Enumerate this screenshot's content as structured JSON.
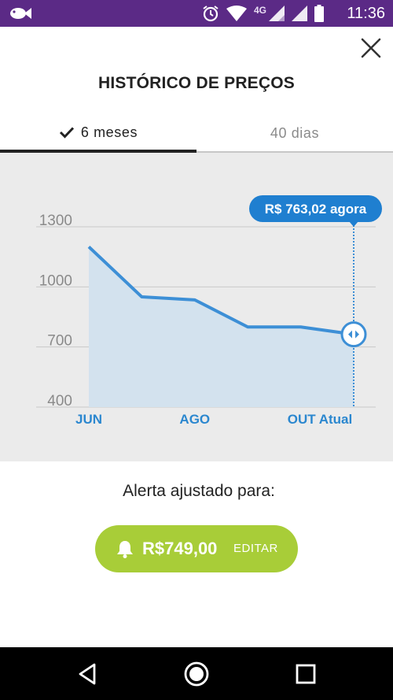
{
  "status_bar": {
    "app_icon": "fish-icon",
    "network_type": "4G",
    "time": "11:36",
    "icons": [
      "alarm-icon",
      "wifi-icon",
      "cell-signal-icon",
      "cell-signal-icon",
      "battery-icon"
    ]
  },
  "header": {
    "title": "HISTÓRICO DE PREÇOS",
    "close_icon": "close-icon"
  },
  "tabs": [
    {
      "label": "6 meses",
      "selected": true,
      "icon": "check-icon"
    },
    {
      "label": "40 dias",
      "selected": false
    }
  ],
  "chart_data": {
    "type": "area",
    "title": "",
    "xlabel": "",
    "ylabel": "",
    "x_ticks": [
      "JUN",
      "AGO",
      "OUT Atual"
    ],
    "y_ticks": [
      1300,
      1000,
      700,
      400
    ],
    "ylim": [
      400,
      1300
    ],
    "series": [
      {
        "values": [
          1200,
          950,
          935,
          800,
          800,
          763
        ]
      }
    ],
    "current_label": "R$ 763,02 agora",
    "grid": true,
    "colors": {
      "line": "#3d8fd6",
      "fill": "#d3e2ee",
      "marker": "#3d8fd6",
      "tooltip": "#1f7fd0",
      "axis_label": "#2b87cf",
      "tick": "#8a8a8a"
    }
  },
  "alert": {
    "label": "Alerta ajustado para:",
    "price": "R$749,00",
    "edit_label": "EDITAR",
    "icon": "bell-icon",
    "color": "#a8cd38"
  },
  "nav_bar": {
    "icons": [
      "back-icon",
      "home-icon",
      "recents-icon"
    ]
  }
}
